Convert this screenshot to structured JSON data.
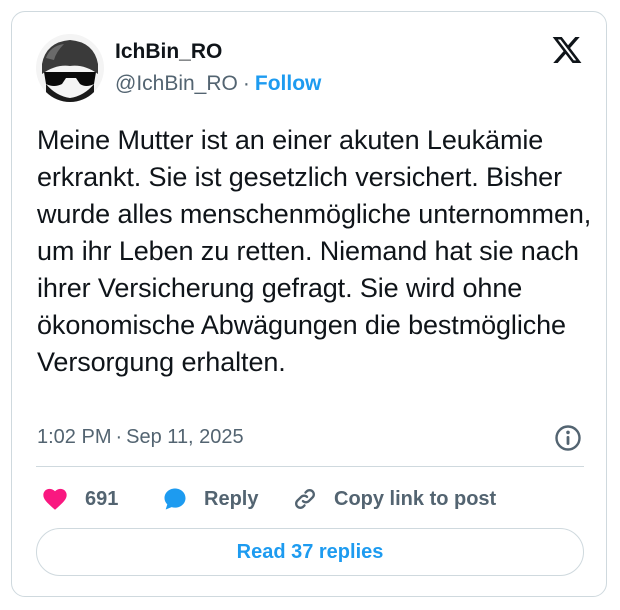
{
  "author": {
    "name": "IchBin_RO",
    "handle": "@IchBin_RO",
    "follow_label": "Follow"
  },
  "brand_icon": "x-logo-icon",
  "tweet": {
    "text": "Meine Mutter ist an einer akuten Leukämie erkrankt. Sie ist gesetzlich versichert. Bisher wurde alles menschenmögliche unternommen, um ihr Leben zu retten. Niemand hat sie nach ihrer Versicherung gefragt. Sie wird ohne ökonomische Abwägungen die bestmögliche Versorgung erhalten.",
    "time": "1:02 PM",
    "separator": "·",
    "date": "Sep 11, 2025"
  },
  "actions": {
    "like_count": "691",
    "reply_label": "Reply",
    "copy_label": "Copy link to post"
  },
  "read_replies_label": "Read 37 replies",
  "colors": {
    "accent": "#1d9bf0",
    "like": "#f91880",
    "text": "#0f1419",
    "muted": "#536471",
    "border": "#cfd9de"
  }
}
